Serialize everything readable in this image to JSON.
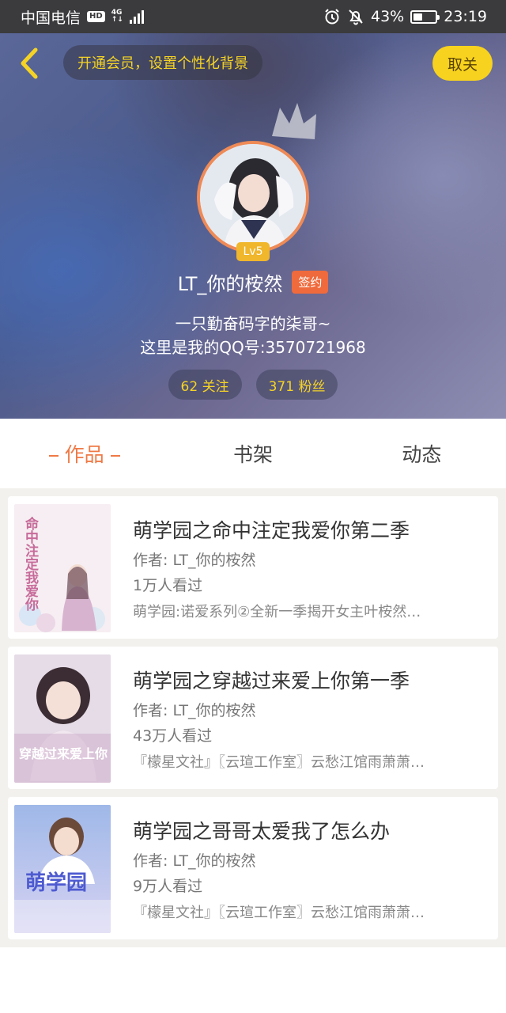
{
  "status_bar": {
    "carrier": "中国电信",
    "hd_badge": "HD",
    "network_type": "4G",
    "battery_percent": "43%",
    "battery_level": 0.43,
    "time": "23:19"
  },
  "header": {
    "vip_banner": "开通会员，设置个性化背景",
    "unfollow_label": "取关"
  },
  "profile": {
    "level": "Lv5",
    "username": "LT_你的桉然",
    "sign_badge": "签约",
    "bio_line1": "一只勤奋码字的柒哥~",
    "bio_line2": "这里是我的QQ号:3570721968",
    "following": "62 关注",
    "followers": "371 粉丝"
  },
  "tabs": [
    {
      "label": "作品",
      "active": true
    },
    {
      "label": "书架",
      "active": false
    },
    {
      "label": "动态",
      "active": false
    }
  ],
  "works": [
    {
      "title": "萌学园之命中注定我爱你第二季",
      "author": "作者: LT_你的桉然",
      "views": "1万人看过",
      "description": "萌学园:诺爱系列②全新一季揭开女主叶桉然…",
      "cover_text": "命中注定我爱你"
    },
    {
      "title": "萌学园之穿越过来爱上你第一季",
      "author": "作者: LT_你的桉然",
      "views": "43万人看过",
      "description": "『檬星文社』〖云瑄工作室〗云愁江馆雨萧萧…",
      "cover_text": "穿越过来爱上你"
    },
    {
      "title": "萌学园之哥哥太爱我了怎么办",
      "author": "作者: LT_你的桉然",
      "views": "9万人看过",
      "description": "『檬星文社』〖云瑄工作室〗云愁江馆雨萧萧…",
      "cover_text": "萌学园"
    }
  ],
  "colors": {
    "accent": "#ef7a46",
    "vip_yellow": "#f5d325",
    "button_yellow": "#f7d21e",
    "sign_orange": "#ef6a3c"
  }
}
